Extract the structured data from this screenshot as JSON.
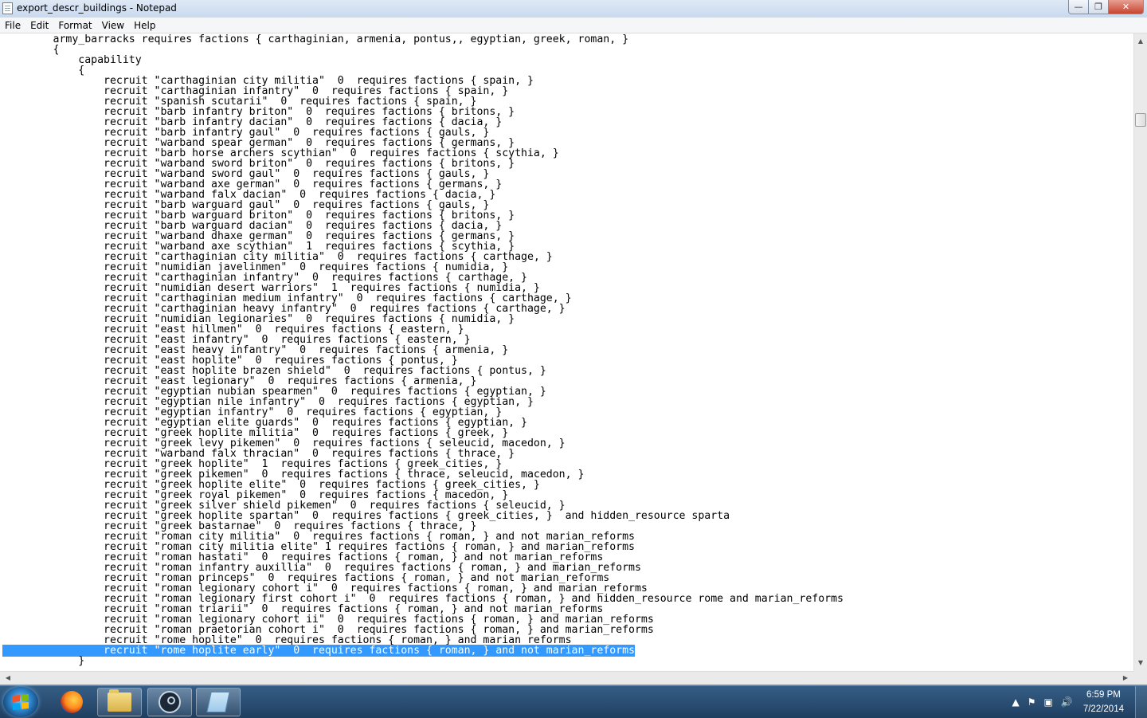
{
  "window": {
    "title": "export_descr_buildings - Notepad",
    "minimize_icon": "minimize-icon",
    "maximize_icon": "maximize-icon",
    "close_icon": "close-icon"
  },
  "menu": [
    "File",
    "Edit",
    "Format",
    "View",
    "Help"
  ],
  "editor": {
    "selected_line_index": 59,
    "lines": [
      "        army_barracks requires factions { carthaginian, armenia, pontus,, egyptian, greek, roman, }",
      "        {",
      "            capability",
      "            {",
      "                recruit \"carthaginian city militia\"  0  requires factions { spain, }",
      "                recruit \"carthaginian infantry\"  0  requires factions { spain, }",
      "                recruit \"spanish scutarii\"  0  requires factions { spain, }",
      "                recruit \"barb infantry briton\"  0  requires factions { britons, }",
      "                recruit \"barb infantry dacian\"  0  requires factions { dacia, }",
      "                recruit \"barb infantry gaul\"  0  requires factions { gauls, }",
      "                recruit \"warband spear german\"  0  requires factions { germans, }",
      "                recruit \"barb horse archers scythian\"  0  requires factions { scythia, }",
      "                recruit \"warband sword briton\"  0  requires factions { britons, }",
      "                recruit \"warband sword gaul\"  0  requires factions { gauls, }",
      "                recruit \"warband axe german\"  0  requires factions { germans, }",
      "                recruit \"warband falx dacian\"  0  requires factions { dacia, }",
      "                recruit \"barb warguard gaul\"  0  requires factions { gauls, }",
      "                recruit \"barb warguard briton\"  0  requires factions { britons, }",
      "                recruit \"barb warguard dacian\"  0  requires factions { dacia, }",
      "                recruit \"warband dhaxe german\"  0  requires factions { germans, }",
      "                recruit \"warband axe scythian\"  1  requires factions { scythia, }",
      "                recruit \"carthaginian city militia\"  0  requires factions { carthage, }",
      "                recruit \"numidian javelinmen\"  0  requires factions { numidia, }",
      "                recruit \"carthaginian infantry\"  0  requires factions { carthage, }",
      "                recruit \"numidian desert warriors\"  1  requires factions { numidia, }",
      "                recruit \"carthaginian medium infantry\"  0  requires factions { carthage, }",
      "                recruit \"carthaginian heavy infantry\"  0  requires factions { carthage, }",
      "                recruit \"numidian legionaries\"  0  requires factions { numidia, }",
      "                recruit \"east hillmen\"  0  requires factions { eastern, }",
      "                recruit \"east infantry\"  0  requires factions { eastern, }",
      "                recruit \"east heavy infantry\"  0  requires factions { armenia, }",
      "                recruit \"east hoplite\"  0  requires factions { pontus, }",
      "                recruit \"east hoplite brazen shield\"  0  requires factions { pontus, }",
      "                recruit \"east legionary\"  0  requires factions { armenia, }",
      "                recruit \"egyptian nubian spearmen\"  0  requires factions { egyptian, }",
      "                recruit \"egyptian nile infantry\"  0  requires factions { egyptian, }",
      "                recruit \"egyptian infantry\"  0  requires factions { egyptian, }",
      "                recruit \"egyptian elite guards\"  0  requires factions { egyptian, }",
      "                recruit \"greek hoplite militia\"  0  requires factions { greek, }",
      "                recruit \"greek levy pikemen\"  0  requires factions { seleucid, macedon, }",
      "                recruit \"warband falx thracian\"  0  requires factions { thrace, }",
      "                recruit \"greek hoplite\"  1  requires factions { greek_cities, }",
      "                recruit \"greek pikemen\"  0  requires factions { thrace, seleucid, macedon, }",
      "                recruit \"greek hoplite elite\"  0  requires factions { greek_cities, }",
      "                recruit \"greek royal pikemen\"  0  requires factions { macedon, }",
      "                recruit \"greek silver shield pikemen\"  0  requires factions { seleucid, }",
      "                recruit \"greek hoplite spartan\"  0  requires factions { greek_cities, }  and hidden_resource sparta",
      "                recruit \"greek bastarnae\"  0  requires factions { thrace, }",
      "                recruit \"roman city militia\"  0  requires factions { roman, } and not marian_reforms",
      "                recruit \"roman city militia elite\" 1 requires factions { roman, } and marian_reforms",
      "                recruit \"roman hastati\"  0  requires factions { roman, } and not marian_reforms",
      "                recruit \"roman infantry auxillia\"  0  requires factions { roman, } and marian_reforms",
      "                recruit \"roman princeps\"  0  requires factions { roman, } and not marian_reforms",
      "                recruit \"roman legionary cohort i\"  0  requires factions { roman, } and marian_reforms",
      "                recruit \"roman legionary first cohort i\"  0  requires factions { roman, } and hidden_resource rome and marian_reforms",
      "                recruit \"roman triarii\"  0  requires factions { roman, } and not marian_reforms",
      "                recruit \"roman legionary cohort ii\"  0  requires factions { roman, } and marian_reforms",
      "                recruit \"roman praetorian cohort i\"  0  requires factions { roman, } and marian_reforms",
      "                recruit \"rome hoplite\"  0  requires factions { roman, } and marian_reforms",
      "                recruit \"rome hoplite early\"  0  requires factions { roman, } and not marian_reforms",
      "            }"
    ]
  },
  "taskbar": {
    "start_icon": "windows-start-icon",
    "pinned": [
      "firefox-icon",
      "file-explorer-icon",
      "steam-icon",
      "notepad-icon"
    ],
    "tray_icons": [
      "show-hidden-icons-chevron",
      "action-center-flag-icon",
      "network-icon",
      "volume-icon"
    ],
    "time": "6:59 PM",
    "date": "7/22/2014"
  },
  "colors": {
    "selection": "#3399ff",
    "taskbar": "#2a4f76"
  }
}
